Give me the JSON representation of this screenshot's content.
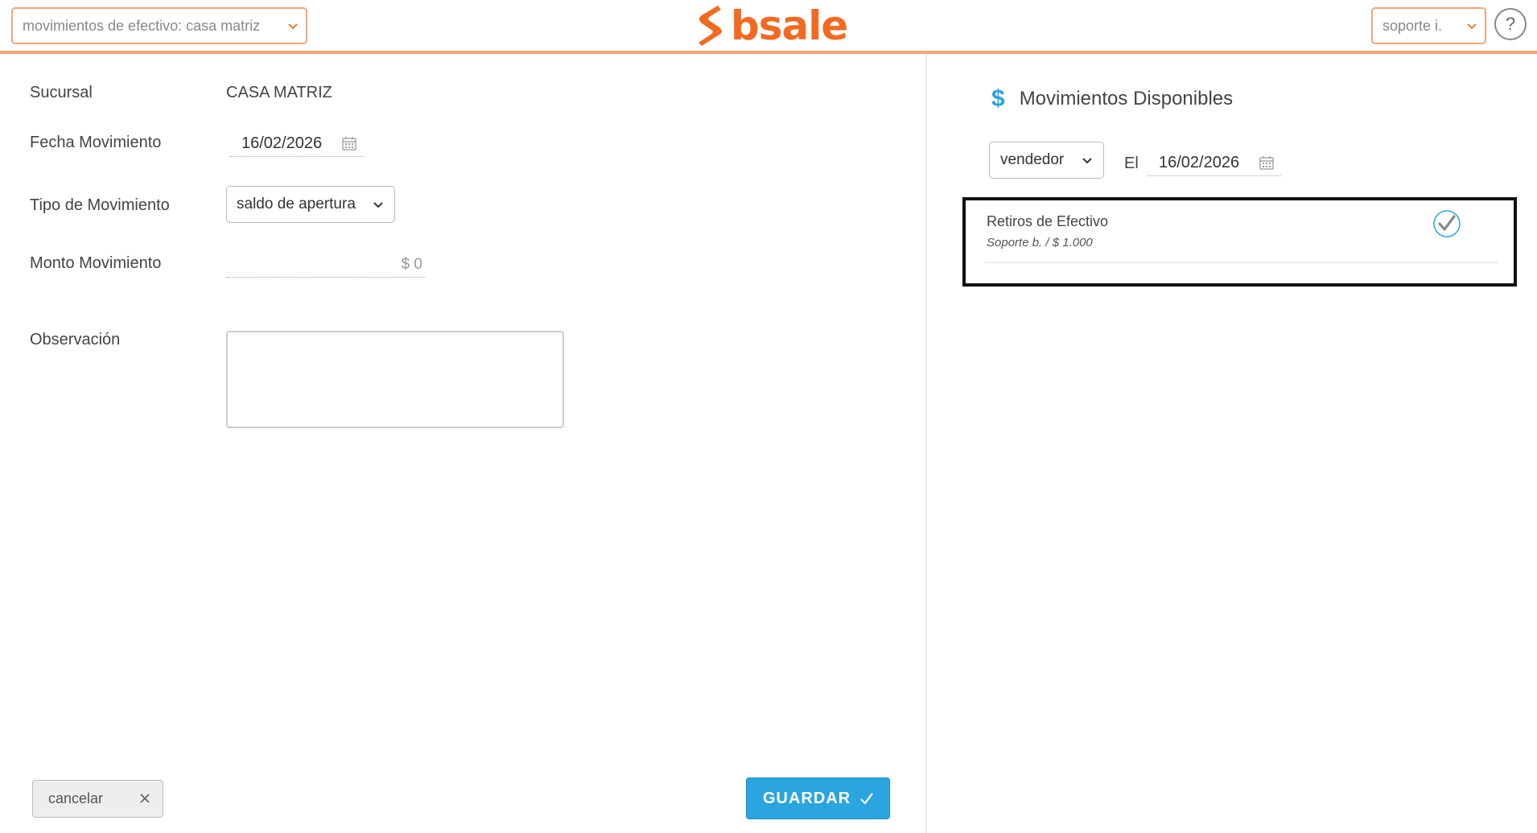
{
  "header": {
    "context_select": "movimientos de efectivo: casa matriz",
    "logo_text": "bsale",
    "user_select": "soporte i.",
    "help_label": "?"
  },
  "form": {
    "sucursal_label": "Sucursal",
    "sucursal_value": "CASA MATRIZ",
    "fecha_label": "Fecha Movimiento",
    "fecha_value": "16/02/2026",
    "tipo_label": "Tipo de Movimiento",
    "tipo_value": "saldo de apertura",
    "monto_label": "Monto Movimiento",
    "monto_value": "$ 0",
    "observacion_label": "Observación",
    "observacion_value": ""
  },
  "actions": {
    "cancel_label": "cancelar",
    "save_label": "GUARDAR"
  },
  "movimientos": {
    "title": "Movimientos Disponibles",
    "filter_select": "vendedor",
    "date_prefix": "El",
    "date_value": "16/02/2026",
    "items": [
      {
        "title": "Retiros de Efectivo",
        "subtitle": "Soporte b. / $ 1.000",
        "checked": true
      }
    ]
  },
  "colors": {
    "brand_orange": "#f26a21",
    "accent_blue": "#2aa5df",
    "header_border": "#f7a57a"
  },
  "icons": [
    "chevron-down-icon",
    "calendar-icon",
    "dollar-icon",
    "check-circle-icon",
    "close-icon",
    "checkmark-icon",
    "help-icon"
  ]
}
